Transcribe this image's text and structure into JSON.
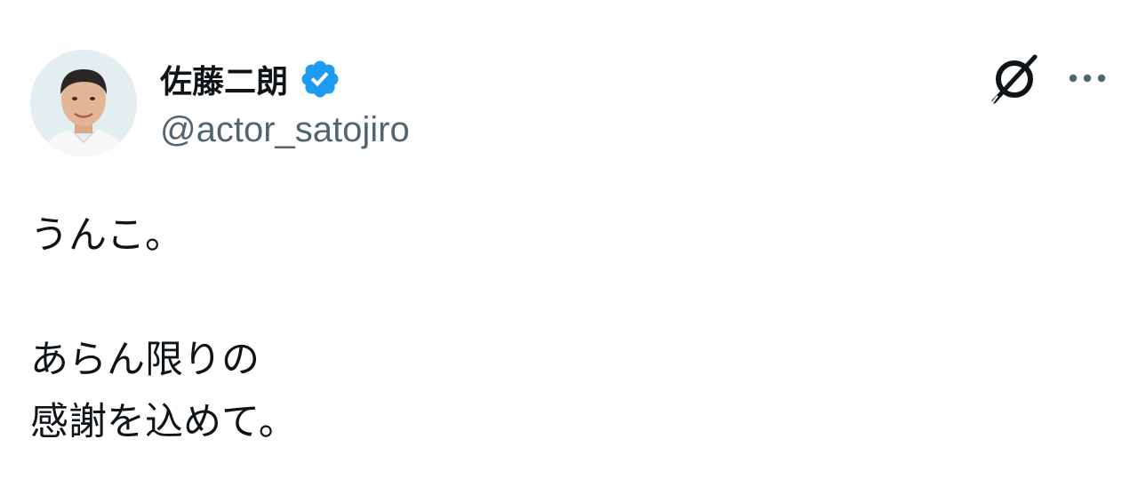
{
  "author": {
    "display_name": "佐藤二朗",
    "handle": "@actor_satojiro",
    "verified": true,
    "verified_color": "#1d9bf0"
  },
  "actions": {
    "grok_icon": "grok-slash-icon",
    "more_icon": "more-dots-icon"
  },
  "tweet": {
    "lines": [
      "うんこ。",
      "",
      "あらん限りの",
      "感謝を込めて。"
    ]
  },
  "colors": {
    "text": "#0f1419",
    "secondary": "#536471",
    "background": "#ffffff"
  }
}
